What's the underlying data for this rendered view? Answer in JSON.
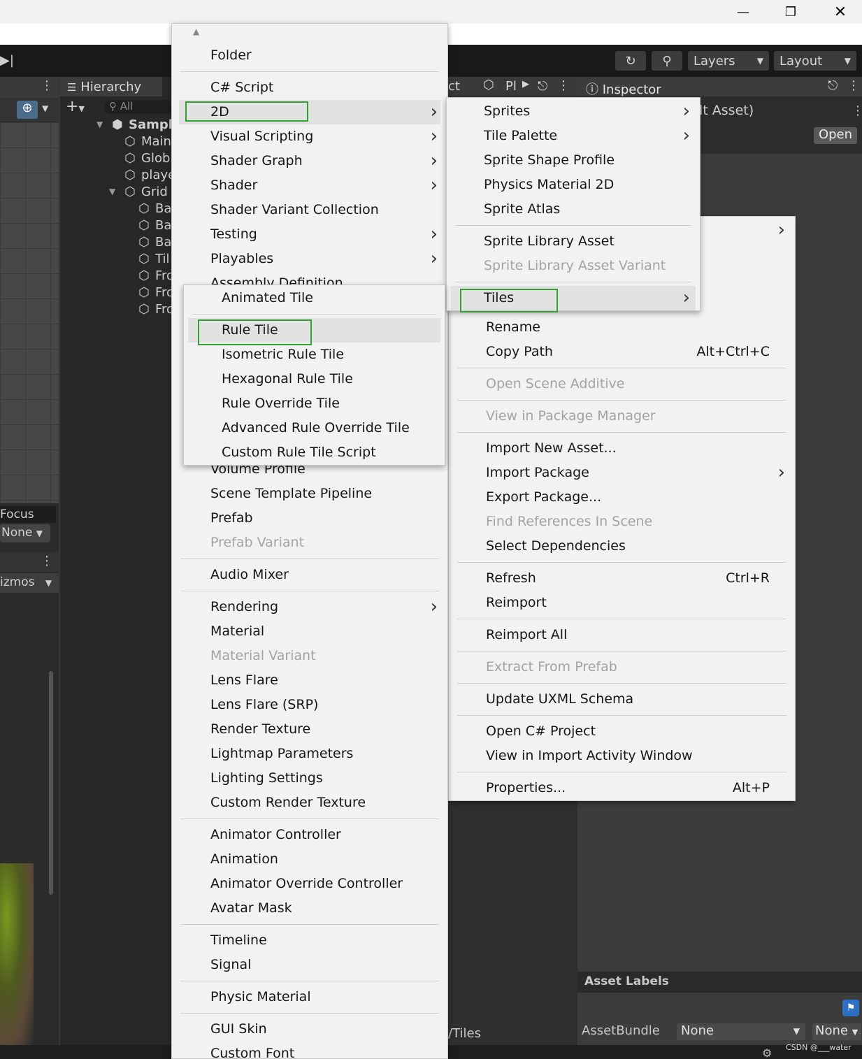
{
  "window": {
    "minimize_icon": "minimize-icon",
    "maximize_icon": "restore-icon",
    "close_icon": "close-icon"
  },
  "toolbar": {
    "layers_label": "Layers",
    "layout_label": "Layout"
  },
  "hierarchy": {
    "tab_label": "Hierarchy",
    "search_placeholder": "All",
    "items": [
      "Sample",
      "Main",
      "Glob",
      "playe",
      "Grid",
      "Ba",
      "Ba",
      "Ba",
      "Til",
      "Fro",
      "Fro",
      "Fro"
    ]
  },
  "scene": {
    "focus_label": "Focus",
    "none_label": "None",
    "gizmos_label": "izmos"
  },
  "project": {
    "tab_label": "ct",
    "second_tab_label": "Pl",
    "path_label": "/Tiles"
  },
  "inspector": {
    "tab_label": "Inspector",
    "asset_title": "lt Asset)",
    "open_button": "Open",
    "asset_labels": "Asset Labels",
    "assetbundle_label": "AssetBundle",
    "assetbundle_value": "None",
    "variant_value": "None"
  },
  "watermark": "CSDN @___water",
  "create_menu": {
    "items": [
      {
        "label": "Folder"
      },
      {
        "sep": true
      },
      {
        "label": "C# Script"
      },
      {
        "label": "2D",
        "arrow": true,
        "hl": true
      },
      {
        "label": "Visual Scripting",
        "arrow": true
      },
      {
        "label": "Shader Graph",
        "arrow": true
      },
      {
        "label": "Shader",
        "arrow": true
      },
      {
        "label": "Shader Variant Collection"
      },
      {
        "label": "Testing",
        "arrow": true
      },
      {
        "label": "Playables",
        "arrow": true
      },
      {
        "label": "Assembly Definition"
      }
    ],
    "lower_items": [
      {
        "label": "Volume Profile"
      },
      {
        "label": "Scene Template Pipeline"
      },
      {
        "label": "Prefab"
      },
      {
        "label": "Prefab Variant",
        "disabled": true
      },
      {
        "sep": true
      },
      {
        "label": "Audio Mixer"
      },
      {
        "sep": true
      },
      {
        "label": "Rendering",
        "arrow": true
      },
      {
        "label": "Material"
      },
      {
        "label": "Material Variant",
        "disabled": true
      },
      {
        "label": "Lens Flare"
      },
      {
        "label": "Lens Flare (SRP)"
      },
      {
        "label": "Render Texture"
      },
      {
        "label": "Lightmap Parameters"
      },
      {
        "label": "Lighting Settings"
      },
      {
        "label": "Custom Render Texture"
      },
      {
        "sep": true
      },
      {
        "label": "Animator Controller"
      },
      {
        "label": "Animation"
      },
      {
        "label": "Animator Override Controller"
      },
      {
        "label": "Avatar Mask"
      },
      {
        "sep": true
      },
      {
        "label": "Timeline"
      },
      {
        "label": "Signal"
      },
      {
        "sep": true
      },
      {
        "label": "Physic Material"
      },
      {
        "sep": true
      },
      {
        "label": "GUI Skin"
      },
      {
        "label": "Custom Font"
      }
    ]
  },
  "sub2d_menu": {
    "items": [
      {
        "label": "Sprites",
        "arrow": true
      },
      {
        "label": "Tile Palette",
        "arrow": true
      },
      {
        "label": "Sprite Shape Profile"
      },
      {
        "label": "Physics Material 2D"
      },
      {
        "label": "Sprite Atlas"
      },
      {
        "sep": true
      },
      {
        "label": "Sprite Library Asset"
      },
      {
        "label": "Sprite Library Asset Variant",
        "disabled": true
      },
      {
        "sep": true
      },
      {
        "label": "Tiles",
        "arrow": true,
        "hl": true
      }
    ]
  },
  "tiles_menu": {
    "items": [
      {
        "label": "Animated Tile"
      },
      {
        "sep": true
      },
      {
        "label": "Rule Tile",
        "hl": true
      },
      {
        "label": "Isometric Rule Tile"
      },
      {
        "label": "Hexagonal Rule Tile"
      },
      {
        "label": "Rule Override Tile"
      },
      {
        "label": "Advanced Rule Override Tile"
      },
      {
        "label": "Custom Rule Tile Script"
      }
    ]
  },
  "context_menu": {
    "items": [
      {
        "label": "",
        "arrow": true
      },
      {
        "spacer": true
      },
      {
        "label": "Rename"
      },
      {
        "label": "Copy Path",
        "shortcut": "Alt+Ctrl+C"
      },
      {
        "sep": true
      },
      {
        "label": "Open Scene Additive",
        "disabled": true
      },
      {
        "sep": true
      },
      {
        "label": "View in Package Manager",
        "disabled": true
      },
      {
        "sep": true
      },
      {
        "label": "Import New Asset..."
      },
      {
        "label": "Import Package",
        "arrow": true
      },
      {
        "label": "Export Package..."
      },
      {
        "label": "Find References In Scene",
        "disabled": true
      },
      {
        "label": "Select Dependencies"
      },
      {
        "sep": true
      },
      {
        "label": "Refresh",
        "shortcut": "Ctrl+R"
      },
      {
        "label": "Reimport"
      },
      {
        "sep": true
      },
      {
        "label": "Reimport All"
      },
      {
        "sep": true
      },
      {
        "label": "Extract From Prefab",
        "disabled": true
      },
      {
        "sep": true
      },
      {
        "label": "Update UXML Schema"
      },
      {
        "sep": true
      },
      {
        "label": "Open C# Project"
      },
      {
        "label": "View in Import Activity Window"
      },
      {
        "sep": true
      },
      {
        "label": "Properties...",
        "shortcut": "Alt+P"
      }
    ]
  }
}
